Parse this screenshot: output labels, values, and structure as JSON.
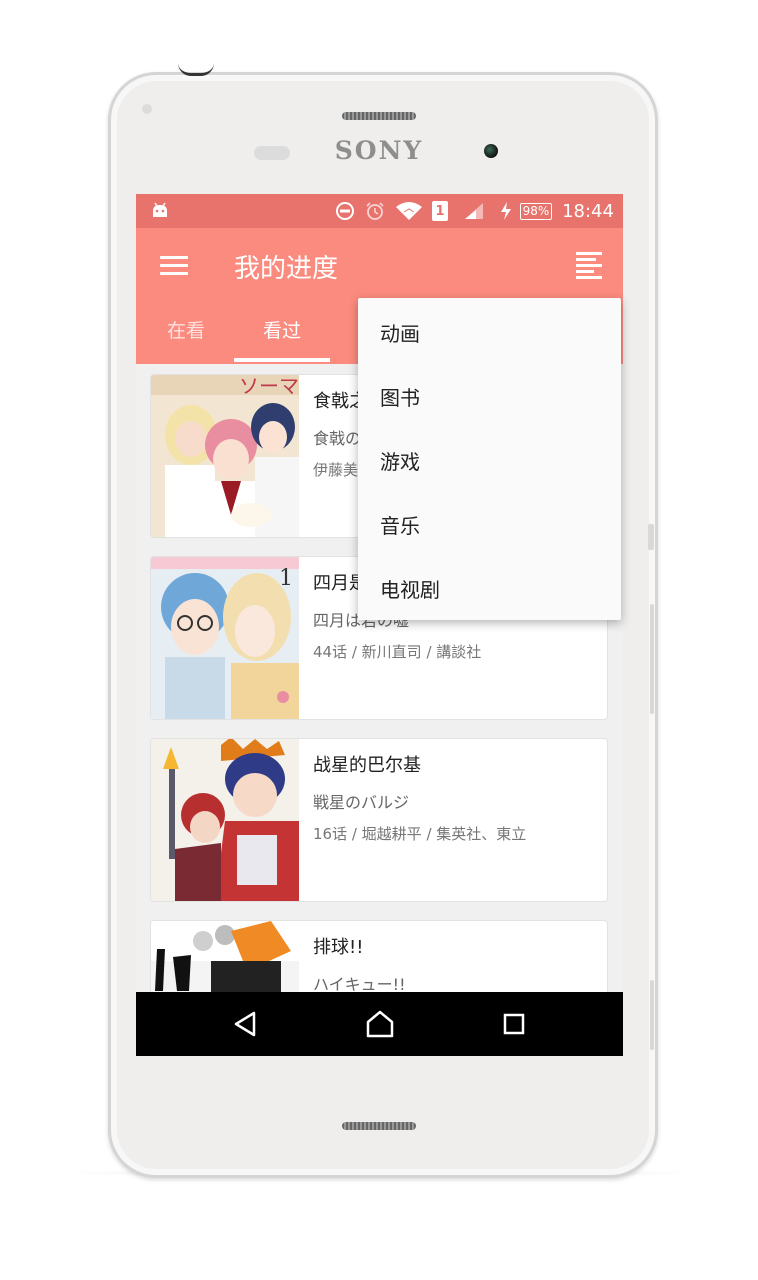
{
  "device": {
    "brand": "SONY"
  },
  "status_bar": {
    "battery": "98%",
    "time": "18:44",
    "sim": "1"
  },
  "app_bar": {
    "title": "我的进度"
  },
  "tabs": [
    {
      "label": "在看",
      "active": false
    },
    {
      "label": "看过",
      "active": true
    }
  ],
  "dropdown": {
    "items": [
      {
        "label": "动画"
      },
      {
        "label": "图书"
      },
      {
        "label": "游戏"
      },
      {
        "label": "音乐"
      },
      {
        "label": "电视剧"
      }
    ]
  },
  "list": {
    "items": [
      {
        "title": "食戟之",
        "subtitle": "食戟の",
        "meta": "伊藤美"
      },
      {
        "title": "四月是",
        "subtitle": "四月は君の嘘",
        "meta": "44话 / 新川直司 / 講談社"
      },
      {
        "title": "战星的巴尔基",
        "subtitle": "戦星のバルジ",
        "meta": "16话 / 堀越耕平 / 集英社、東立"
      },
      {
        "title": "排球!!",
        "subtitle": "ハイキュー!!",
        "meta": ""
      }
    ]
  },
  "colors": {
    "accent": "#fc8b7f",
    "status_bar": "#e8736d",
    "nav_bar": "#000000"
  },
  "icons": [
    "android-icon",
    "do-not-disturb-icon",
    "alarm-icon",
    "wifi-icon",
    "sim-icon",
    "signal-icon",
    "charging-icon",
    "menu-icon",
    "sort-icon",
    "back-icon",
    "home-icon",
    "recents-icon"
  ]
}
